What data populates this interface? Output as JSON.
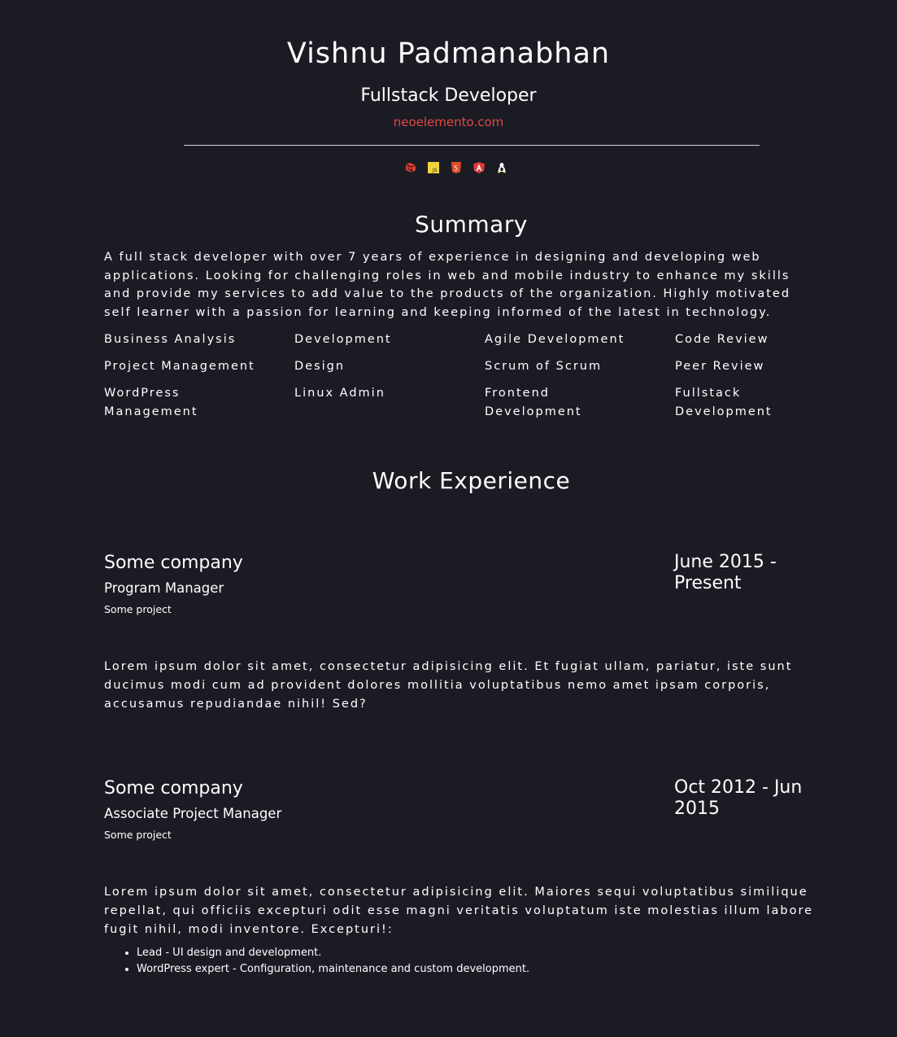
{
  "header": {
    "name": "Vishnu Padmanabhan",
    "role": "Fullstack Developer",
    "website": "neoelemento.com",
    "tech_icons": [
      "laravel-icon",
      "javascript-icon",
      "html5-icon",
      "angular-icon",
      "linux-icon"
    ]
  },
  "summary": {
    "title": "Summary",
    "text": "A full stack developer with over 7 years of experience in designing and developing web applications. Looking for challenging roles in web and mobile industry to enhance my skills and provide my services to add value to the products of the organization. Highly motivated self learner with a passion for learning and keeping informed of the latest in technology.",
    "skills": [
      "Business Analysis",
      "Development",
      "Agile Development",
      "Code Review",
      "Project Management",
      "Design",
      "Scrum of Scrum",
      "Peer Review",
      "WordPress Management",
      "Linux Admin",
      "Frontend Development",
      "Fullstack Development"
    ]
  },
  "work": {
    "title": "Work Experience",
    "jobs": [
      {
        "company": "Some company",
        "position": "Program Manager",
        "project": "Some project",
        "dates": "June 2015 - Present",
        "description": "Lorem ipsum dolor sit amet, consectetur adipisicing elit. Et fugiat ullam, pariatur, iste sunt ducimus modi cum ad provident dolores mollitia voluptatibus nemo amet ipsam corporis, accusamus repudiandae nihil! Sed?"
      },
      {
        "company": "Some company",
        "position": "Associate Project Manager",
        "project": "Some project",
        "dates": "Oct 2012 - Jun 2015",
        "description": "Lorem ipsum dolor sit amet, consectetur adipisicing elit. Maiores sequi voluptatibus similique repellat, qui officiis excepturi odit esse magni veritatis voluptatum iste molestias illum labore fugit nihil, modi inventore. Excepturi!:",
        "bullets": [
          "Lead - UI design and development.",
          "WordPress expert - Configuration, maintenance and custom development."
        ]
      }
    ]
  },
  "colors": {
    "background": "#1b1b24",
    "accent": "#e04848",
    "text": "#ffffff"
  }
}
